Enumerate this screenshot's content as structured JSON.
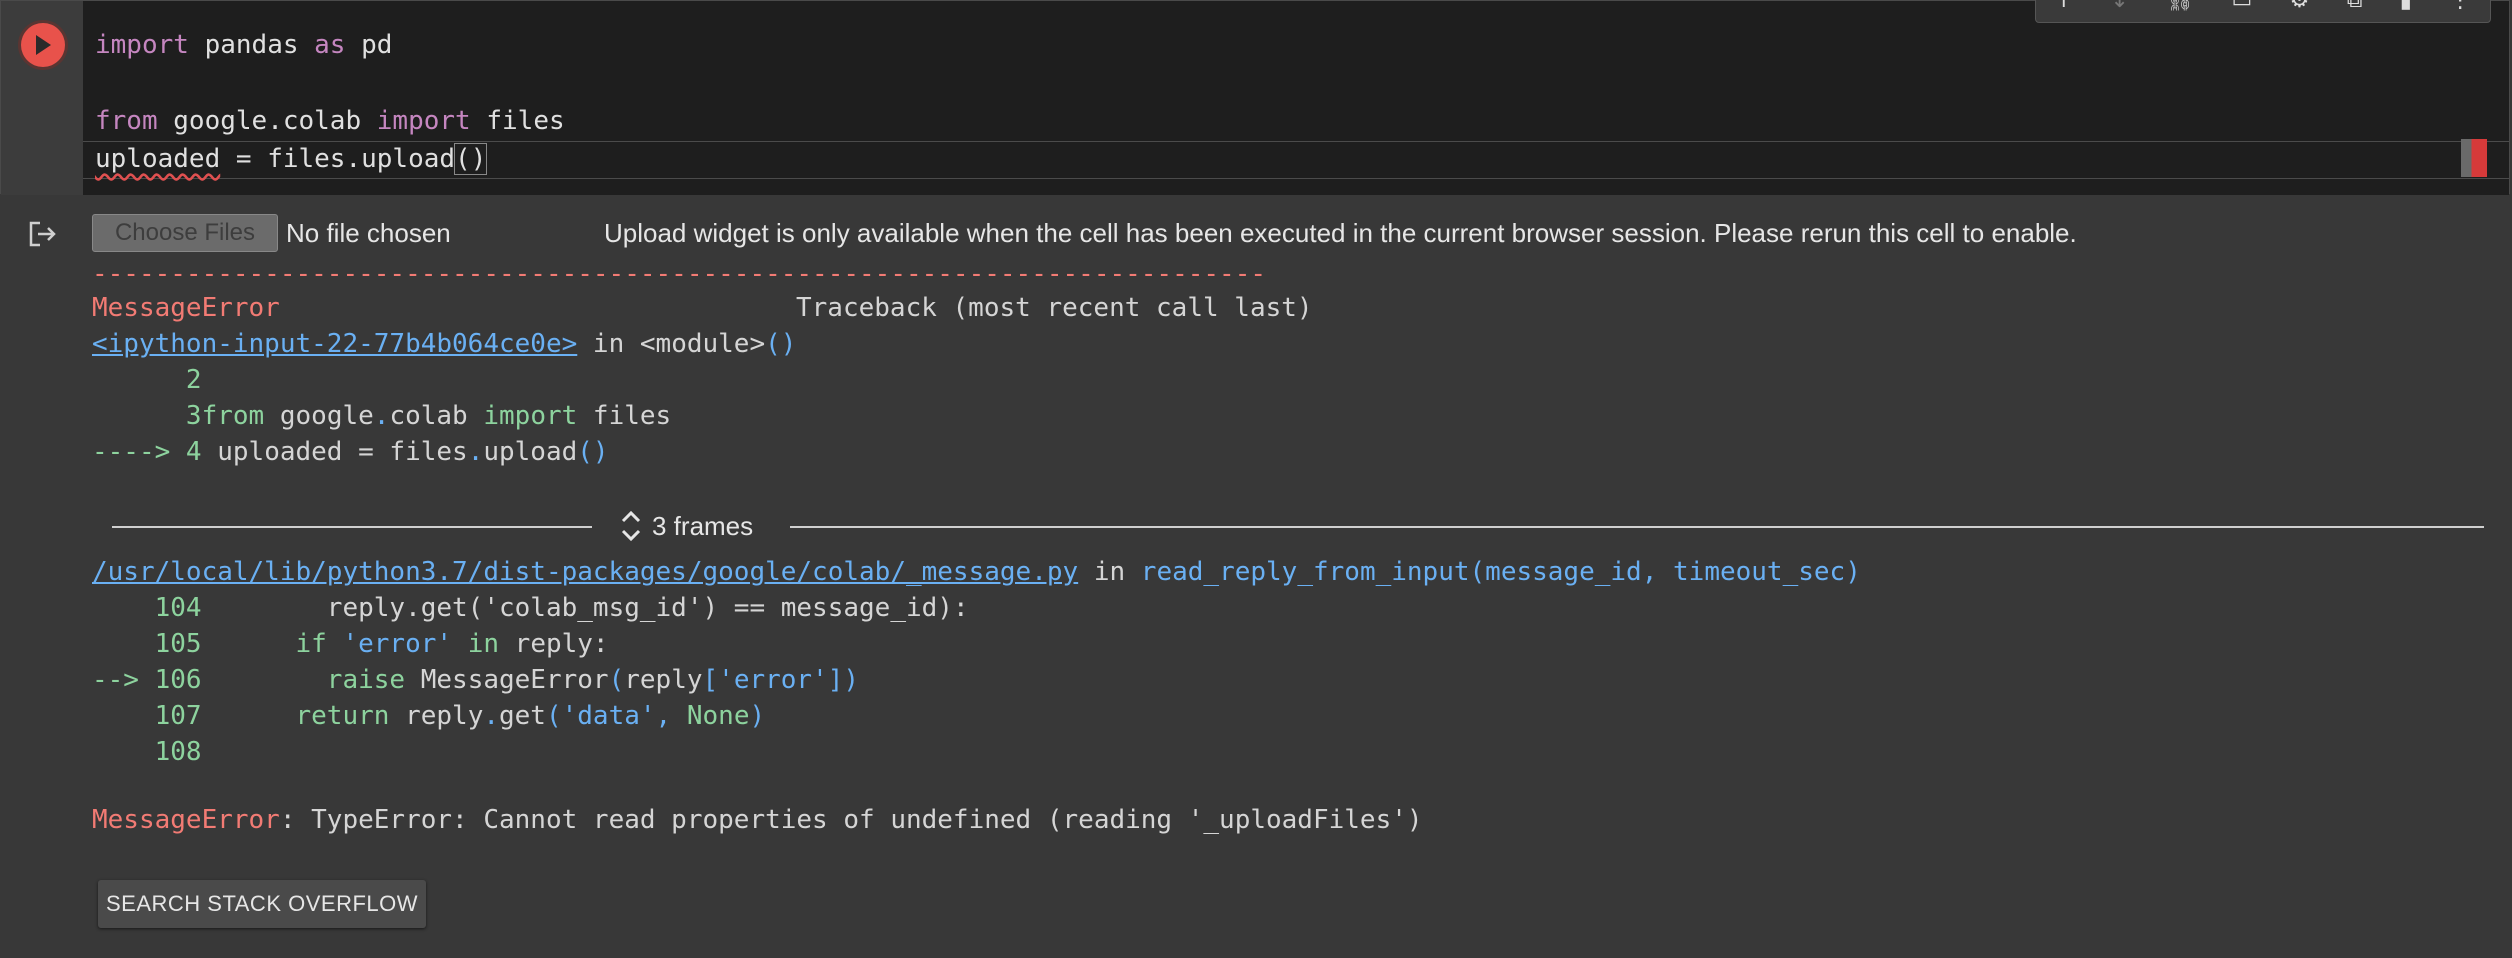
{
  "code_cell": {
    "lines": [
      {
        "kw1": "import",
        "t1": " pandas ",
        "kw2": "as",
        "t2": " pd"
      },
      {
        "kw1": "from",
        "t1": " google.colab ",
        "kw2": "import",
        "t2": " files"
      }
    ],
    "line3_var": "uploaded",
    "line3_rest": " = files.upload",
    "line3_parens": "()"
  },
  "output": {
    "choose_files_label": "Choose Files",
    "no_file_text": "No file chosen",
    "widget_notice": "Upload widget is only available when the cell has been executed in the current browser session. Please rerun this cell to enable.",
    "dash_rule": "---------------------------------------------------------------------------",
    "error_name": "MessageError",
    "traceback_header": "Traceback (most recent call last)",
    "frame1_link": "<ipython-input-22-77b4b064ce0e>",
    "frame1_in": " in ",
    "frame1_module": "<module>",
    "frame1_module_parens": "()",
    "frame1_lines": {
      "l2_num": "      2",
      "l3_num": "      3",
      "l3_from": "from",
      "l3_pkg": " google",
      "l3_dot": ".",
      "l3_colab": "colab ",
      "l3_import": "import",
      "l3_files": " files",
      "l4_arrow": "----> 4",
      "l4_code": " uploaded = files",
      "l4_dot": ".",
      "l4_upload": "upload",
      "l4_parens": "()"
    },
    "frames_label": "3 frames",
    "frame2_link": "/usr/local/lib/python3.7/dist-packages/google/colab/_message.py",
    "frame2_in": " in ",
    "frame2_func": "read_reply_from_input(message_id, timeout_sec)",
    "frame2_lines": {
      "n104": "    104",
      "c104": "        reply.get('colab_msg_id') == message_id):",
      "n105": "    105",
      "c105_if": "      if",
      "c105_str": " 'error'",
      "c105_in": " in",
      "c105_rest": " reply:",
      "n106": "--> 106",
      "c106_raise": "        raise",
      "c106_cls": " MessageError",
      "c106_p1": "(",
      "c106_reply": "reply",
      "c106_br": "['error']",
      "c106_p2": ")",
      "n107": "    107",
      "c107_return": "      return",
      "c107_reply": " reply",
      "c107_dot": ".",
      "c107_get": "get",
      "c107_p1": "(",
      "c107_str": "'data'",
      "c107_comma": ", ",
      "c107_none": "None",
      "c107_p2": ")",
      "n108": "    108"
    },
    "final_error_name": "MessageError",
    "final_error_msg": ": TypeError: Cannot read properties of undefined (reading '_uploadFiles')",
    "search_so_label": "SEARCH STACK OVERFLOW"
  },
  "icons": {
    "run": "play-icon",
    "output_menu": "output-exit-icon",
    "frames_toggle": "chevron-updown-icon"
  },
  "colors": {
    "run_button": "#e8524b",
    "error_text": "#f27b74",
    "link": "#6ab0f3",
    "line_number": "#8dd39e"
  }
}
